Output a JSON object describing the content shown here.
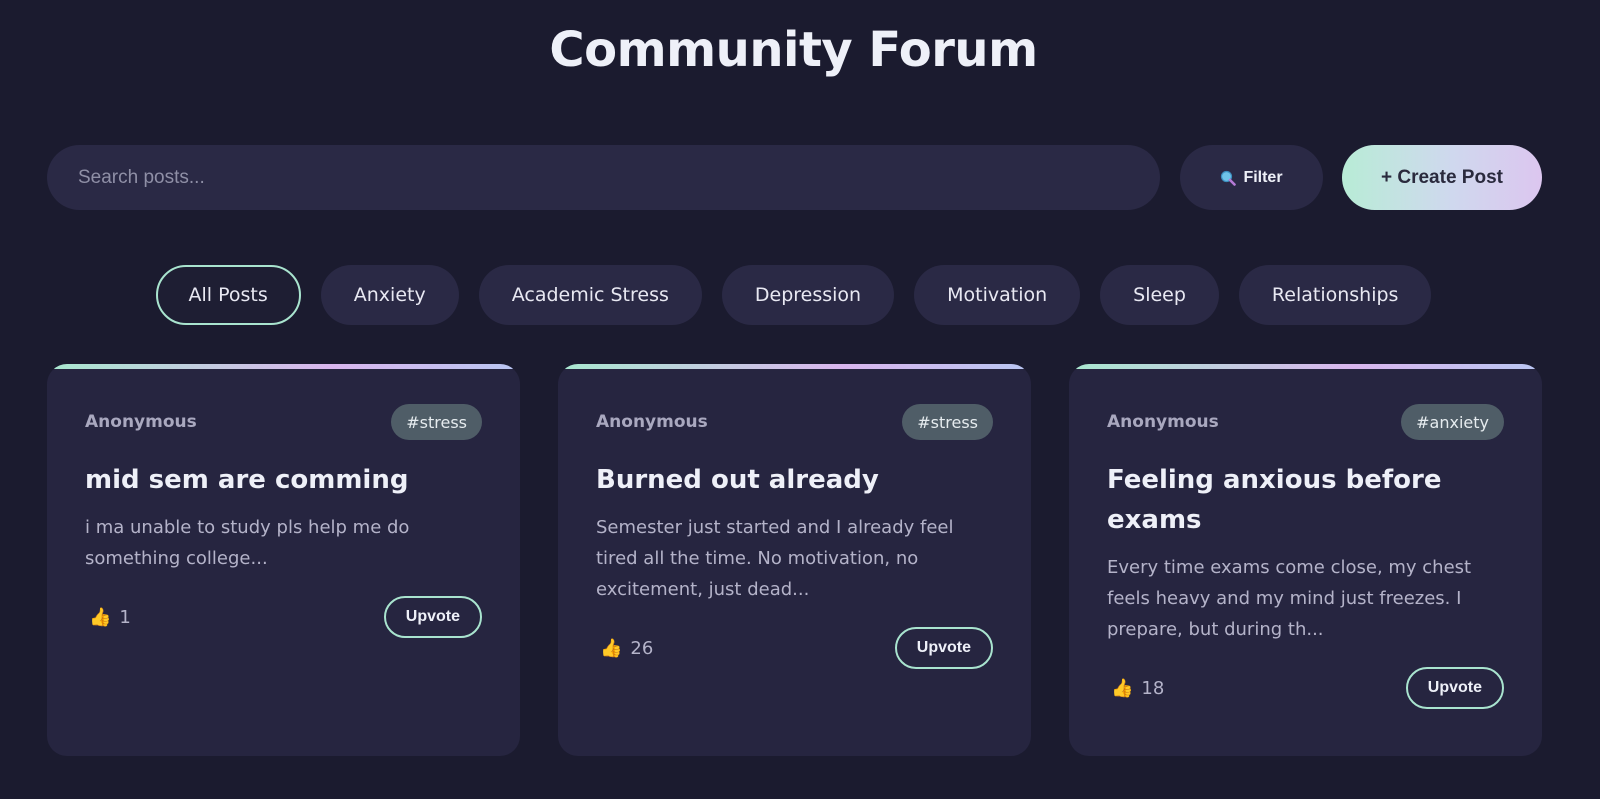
{
  "header": {
    "title": "Community Forum"
  },
  "search": {
    "placeholder": "Search posts..."
  },
  "toolbar": {
    "filter_label": "Filter",
    "filter_icon": "magnifier-icon",
    "create_label": "+ Create Post"
  },
  "categories": [
    {
      "label": "All Posts",
      "active": true
    },
    {
      "label": "Anxiety"
    },
    {
      "label": "Academic Stress"
    },
    {
      "label": "Depression"
    },
    {
      "label": "Motivation"
    },
    {
      "label": "Sleep"
    },
    {
      "label": "Relationships"
    }
  ],
  "posts": [
    {
      "author": "Anonymous",
      "tag": "#stress",
      "title": "mid sem are comming",
      "excerpt": "i ma unable to study pls help me do something college...",
      "likes": "1",
      "upvote_label": "Upvote"
    },
    {
      "author": "Anonymous",
      "tag": "#stress",
      "title": "Burned out already",
      "excerpt": "Semester just started and I already feel tired all the time. No motivation, no excitement, just dead...",
      "likes": "26",
      "upvote_label": "Upvote"
    },
    {
      "author": "Anonymous",
      "tag": "#anxiety",
      "title": "Feeling anxious before exams",
      "excerpt": "Every time exams come close, my chest feels heavy and my mind just freezes. I prepare, but during th...",
      "likes": "18",
      "upvote_label": "Upvote"
    }
  ],
  "colors": {
    "background": "#1b1b2f",
    "surface": "#2a2945",
    "card": "#262540",
    "accent": "#a9e4cf",
    "tag": "#4f5d67"
  }
}
